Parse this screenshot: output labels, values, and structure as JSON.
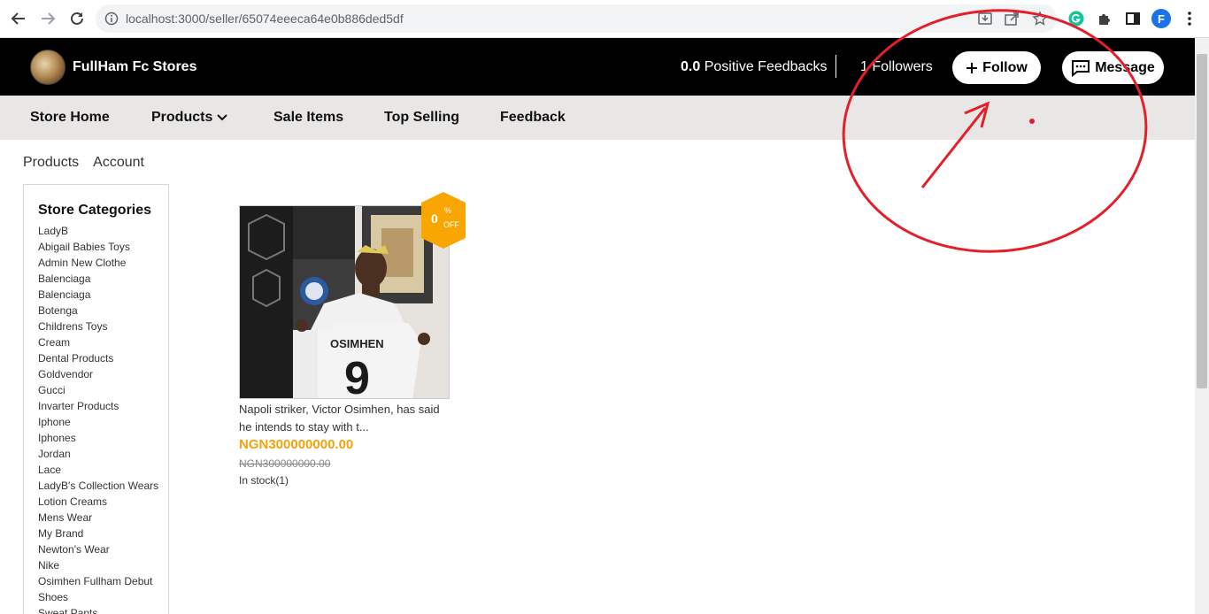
{
  "browser": {
    "url": "localhost:3000/seller/65074eeeca64e0b886ded5df",
    "profile_initial": "F"
  },
  "header": {
    "store_name": "FullHam Fc Stores",
    "feedback_value": "0.0",
    "feedback_label": "Positive Feedbacks",
    "followers_text": "1 Followers",
    "follow_label": "Follow",
    "message_label": "Message"
  },
  "nav": {
    "store_home": "Store Home",
    "products": "Products",
    "sale_items": "Sale Items",
    "top_selling": "Top Selling",
    "feedback": "Feedback"
  },
  "tabs": {
    "products": "Products",
    "account": "Account"
  },
  "sidebar": {
    "title": "Store Categories",
    "categories": [
      "LadyB",
      "Abigail Babies Toys",
      "Admin New Clothe",
      "Balenciaga",
      "Balenciaga",
      "Botenga",
      "Childrens Toys",
      "Cream",
      "Dental Products",
      "Goldvendor",
      "Gucci",
      "Invarter Products",
      "Iphone",
      "Iphones",
      "Jordan",
      "Lace",
      "LadyB's Collection Wears",
      "Lotion Creams",
      "Mens Wear",
      "My Brand",
      "Newton's Wear",
      "Nike",
      "Osimhen Fullham Debut",
      "Shoes",
      "Sweat Pants"
    ]
  },
  "product": {
    "discount_value": "0",
    "discount_pct": "%",
    "discount_off": "OFF",
    "title_line1": "Napoli striker, Victor Osimhen, has said",
    "title_line2": "he intends to stay with t...",
    "price": "NGN300000000.00",
    "old_price": "NGN300000000.00",
    "stock": "In stock(1)",
    "jersey_name": "OSIMHEN",
    "jersey_number": "9"
  },
  "colors": {
    "header_bg": "#000000",
    "nav_bg": "#e9e7e6",
    "price": "#f5a20a",
    "discount_badge": "#f9a602",
    "annotation": "#e3202a"
  }
}
